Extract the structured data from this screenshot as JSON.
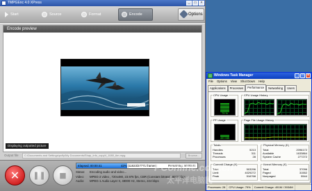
{
  "tmpgenc": {
    "title": "TMPGEnc 4.0 XPress",
    "steps": [
      {
        "label": "Start"
      },
      {
        "label": "Source"
      },
      {
        "label": "Format"
      },
      {
        "label": "Encode"
      }
    ],
    "options_label": "Options",
    "preview_title": "Encode preview",
    "display_status": "Displaying outputted picture",
    "output_label": "Output file",
    "output_path": "C:\\Documents and Settings\\pcfly\\My Documents\\Shap_info_copy\\f_1080_tim.mpg",
    "browse_label": "Browse...",
    "progress": {
      "fraction": 0.42,
      "elapsed": "Elapsed: 00:00:41",
      "percent_frames": "42% (11823/27771 frames)",
      "remaining": "Remaining: 00:00:41"
    },
    "status_label": "Status:",
    "status_value": "Encoding audio and video...",
    "video_label": "Video:",
    "video_value": "MPEG-2 video , 720x480, 23.976 fps, CBR (Constant bitrate), 8000 kbps",
    "audio_label": "Audio:",
    "audio_value": "MPEG-1 Audio Layer II, 48000 Hz, Stereo, 224 kbps"
  },
  "taskmgr": {
    "title": "Windows Task Manager",
    "menu": [
      "File",
      "Options",
      "View",
      "Shut Down",
      "Help"
    ],
    "tabs": [
      "Applications",
      "Processes",
      "Performance",
      "Networking",
      "Users"
    ],
    "active_tab": "Performance",
    "cpu_usage_label": "CPU Usage",
    "cpu_history_label": "CPU Usage History",
    "cpu_value": "79 %",
    "cpu_fraction": 0.79,
    "pf_usage_label": "PF Usage",
    "pf_history_label": "Page File Usage History",
    "pf_value": "491 MB",
    "pf_fraction": 0.25,
    "totals": {
      "title": "Totals",
      "rows": [
        [
          "Handles",
          "5213"
        ],
        [
          "Threads",
          "311"
        ],
        [
          "Processes",
          "28"
        ]
      ]
    },
    "physical": {
      "title": "Physical Memory (K)",
      "rows": [
        [
          "Total",
          "2096172"
        ],
        [
          "Available",
          "1633864"
        ],
        [
          "System Cache",
          "277272"
        ]
      ]
    },
    "commit": {
      "title": "Commit Charge (K)",
      "rows": [
        [
          "Total",
          "503296"
        ],
        [
          "Limit",
          "4029272"
        ],
        [
          "Peak",
          "516768"
        ]
      ]
    },
    "kernel": {
      "title": "Kernel Memory (K)",
      "rows": [
        [
          "Total",
          "37096"
        ],
        [
          "Paged",
          "31552"
        ],
        [
          "Nonpaged",
          "5544"
        ]
      ]
    },
    "status": [
      "Processes: 28",
      "CPU Usage: 79%",
      "Commit Charge: 491M / 3934M"
    ]
  },
  "watermark": "PConline.com.cn",
  "watermark2": "太平洋电脑网"
}
